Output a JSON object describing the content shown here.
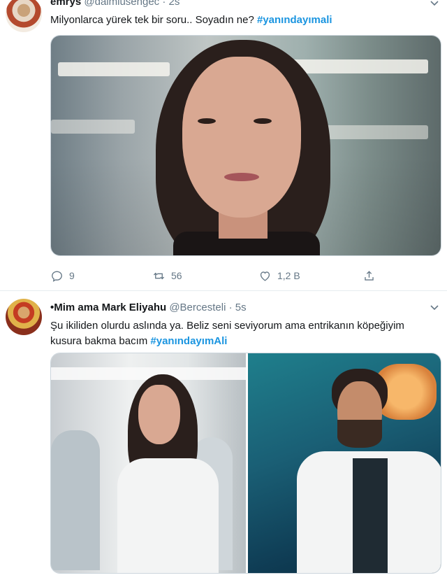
{
  "tweets": [
    {
      "display_name": "emrys",
      "handle": "@daimiusengec",
      "separator": "·",
      "time": "2s",
      "text_before": "Milyonlarca yürek tek bir soru.. Soyadın ne? ",
      "hashtag": "#yanındayımali",
      "actions": {
        "reply_count": "9",
        "retweet_count": "56",
        "like_count": "1,2 B"
      },
      "icons": [
        "reply-icon",
        "retweet-icon",
        "like-icon",
        "share-icon"
      ]
    },
    {
      "display_name": "•Mim ama Mark Eliyahu",
      "handle": "@Bercesteli",
      "separator": "·",
      "time": "5s",
      "text_before": "Şu ikiliden olurdu aslında ya. Beliz seni seviyorum ama entrikanın köpeğiyim kusura bakma bacım ",
      "hashtag": "#yanındayımAli"
    }
  ],
  "colors": {
    "hashtag": "#1b95e0",
    "secondary_text": "#657786",
    "divider": "#e6ecf0"
  }
}
